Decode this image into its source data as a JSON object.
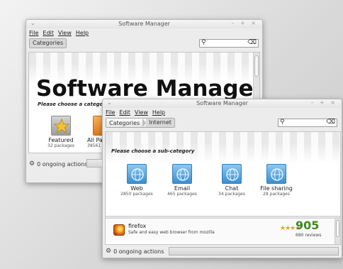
{
  "back_window": {
    "title": "Software Manager",
    "menu": [
      "File",
      "Edit",
      "View",
      "Help"
    ],
    "breadcrumb": [
      "Categories"
    ],
    "heading": "Software Manager",
    "subheading": "Please choose a category",
    "categories": [
      {
        "name": "Featured",
        "count": "32 packages",
        "icon": "star-icon"
      },
      {
        "name": "All Pa",
        "count": "38561",
        "icon": "all-packages-icon"
      }
    ],
    "status": "0 ongoing actions"
  },
  "front_window": {
    "title": "Software Manager",
    "menu": [
      "File",
      "Edit",
      "View",
      "Help"
    ],
    "breadcrumb": [
      "Categories",
      "Internet"
    ],
    "subheading": "Please choose a sub-category",
    "subcategories": [
      {
        "name": "Web",
        "count": "2850 packages",
        "icon": "globe-icon"
      },
      {
        "name": "Email",
        "count": "465 packages",
        "icon": "globe-icon"
      },
      {
        "name": "Chat",
        "count": "34 packages",
        "icon": "globe-icon"
      },
      {
        "name": "File sharing",
        "count": "28 packages",
        "icon": "globe-icon"
      }
    ],
    "featured_app": {
      "name": "firefox",
      "description": "Safe and easy web browser from mozilla",
      "score": "905",
      "reviews": "680 reviews",
      "stars": 4
    },
    "status": "0 ongoing actions"
  },
  "colors": {
    "score_green": "#3c8a1e",
    "star_gold": "#e2a416",
    "tile_blue": "#3a8fd1"
  }
}
